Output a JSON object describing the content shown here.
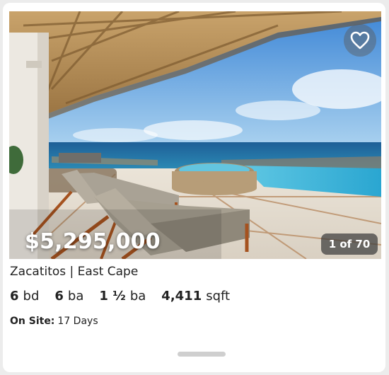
{
  "listing": {
    "price": "$5,295,000",
    "photo_counter": "1 of 70",
    "location": "Zacatitos | East Cape",
    "specs": [
      {
        "num": "6",
        "unit": "bd"
      },
      {
        "num": "6",
        "unit": "ba"
      },
      {
        "num": "1 ½",
        "unit": "ba"
      },
      {
        "num": "4,411",
        "unit": "sqft"
      }
    ],
    "on_site_label": "On Site:",
    "on_site_value": "17 Days",
    "favorite_icon": "heart-outline-icon"
  }
}
